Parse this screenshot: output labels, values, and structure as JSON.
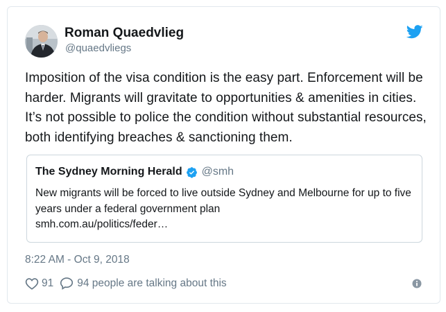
{
  "tweet": {
    "display_name": "Roman Quaedvlieg",
    "handle": "@quaedvliegs",
    "text": "Imposition of the visa condition is the easy part. Enforcement will be harder. Migrants will gravitate to opportunities & amenities in cities. It’s not possible to police the condition without substantial resources, both identifying breaches & sanctioning them.",
    "timestamp": "8:22 AM - Oct 9, 2018",
    "likes": "91",
    "talking": "94 people are talking about this"
  },
  "quote": {
    "name": "The Sydney Morning Herald",
    "handle": "@smh",
    "text": "New migrants will be forced to live outside Sydney and Melbourne for up to five years under a federal government plan",
    "link": "smh.com.au/politics/feder…"
  },
  "icons": {
    "brand": "twitter-bird-icon",
    "verified": "verified-badge-icon",
    "like": "heart-icon",
    "reply": "speech-bubble-icon",
    "info": "info-icon"
  },
  "colors": {
    "brand_blue": "#1da1f2",
    "text_primary": "#14171a",
    "text_secondary": "#657786",
    "border": "#e1e8ed"
  }
}
